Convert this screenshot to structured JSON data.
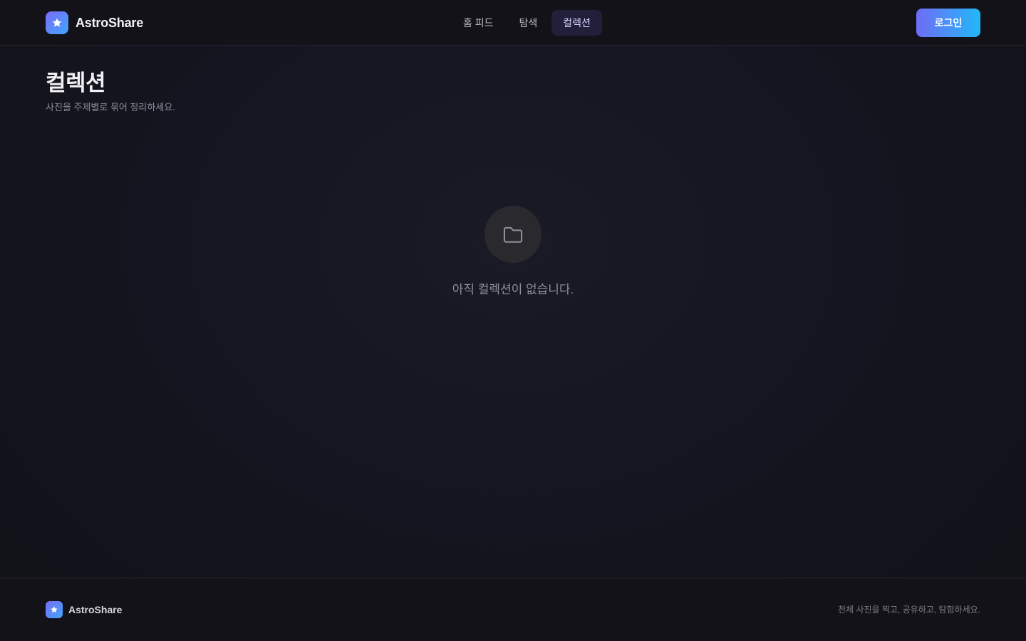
{
  "header": {
    "brand_name": "AstroShare",
    "nav": [
      {
        "label": "홈 피드",
        "active": false
      },
      {
        "label": "탐색",
        "active": false
      },
      {
        "label": "컬렉션",
        "active": true
      }
    ],
    "login_label": "로그인"
  },
  "page": {
    "title": "컬렉션",
    "subtitle": "사진을 주제별로 묶어 정리하세요."
  },
  "empty_state": {
    "icon": "folder-icon",
    "message": "아직 컬렉션이 없습니다."
  },
  "footer": {
    "brand_name": "AstroShare",
    "tagline": "천체 사진을 찍고, 공유하고, 탐험하세요."
  },
  "colors": {
    "accent_start": "#7b6cf6",
    "accent_end": "#22b8f8",
    "background": "#141520"
  }
}
